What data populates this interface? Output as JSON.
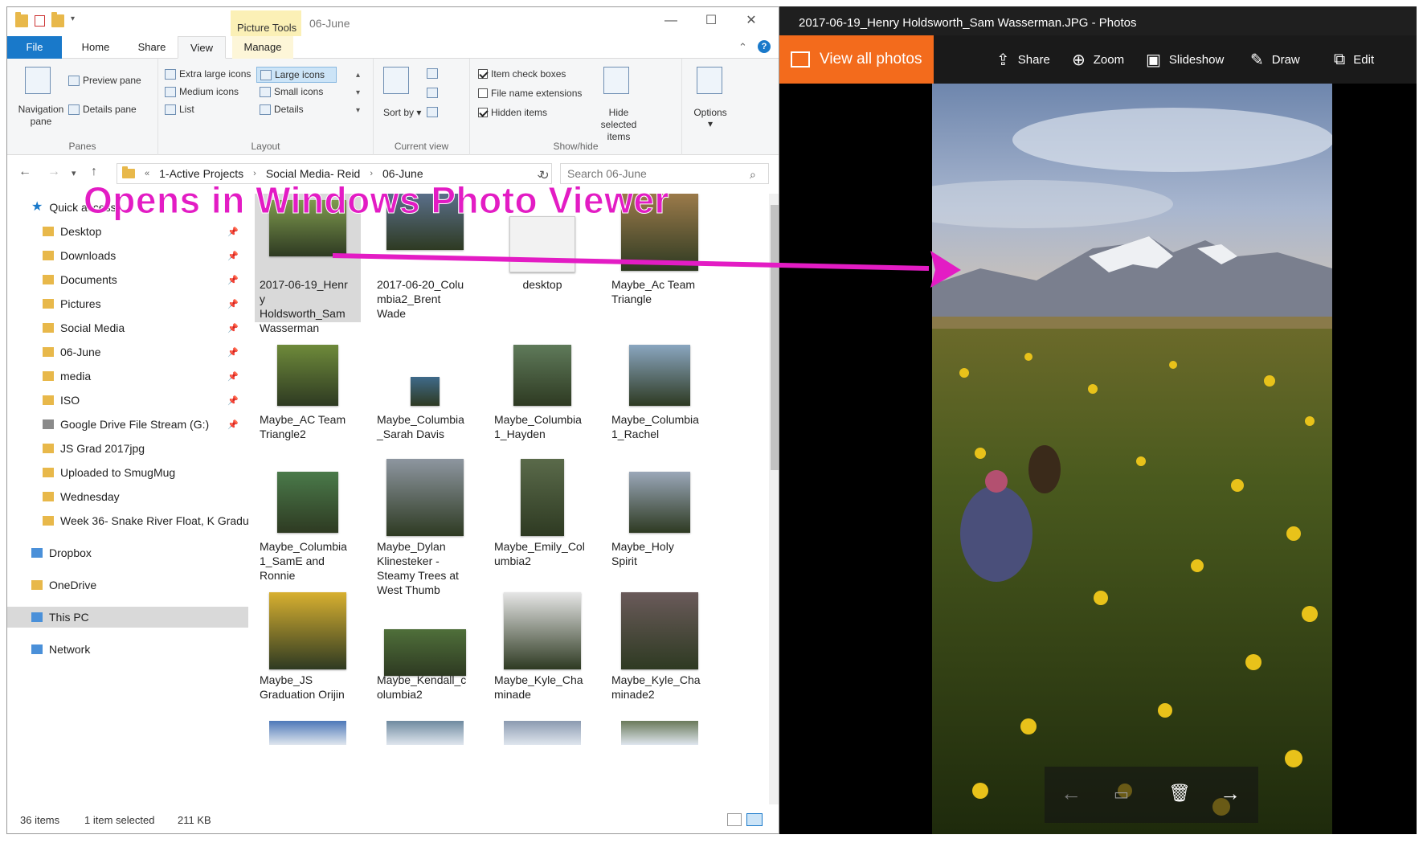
{
  "explorer": {
    "title": "06-June",
    "context_tab": "Picture Tools",
    "tabs": [
      "File",
      "Home",
      "Share",
      "View",
      "Manage"
    ],
    "ribbon": {
      "panes": {
        "navigation_pane": "Navigation pane",
        "preview_pane": "Preview pane",
        "details_pane": "Details pane",
        "label": "Panes"
      },
      "layout": {
        "items": [
          "Extra large icons",
          "Large icons",
          "Medium icons",
          "Small icons",
          "List",
          "Details"
        ],
        "selected": "Large icons",
        "label": "Layout"
      },
      "current_view": {
        "sort_by": "Sort by",
        "label": "Current view"
      },
      "show_hide": {
        "item_check_boxes": "Item check boxes",
        "file_name_extensions": "File name extensions",
        "hidden_items": "Hidden items",
        "hide_selected_items": "Hide selected items",
        "label": "Show/hide"
      },
      "options": "Options"
    },
    "address": {
      "crumbs": [
        "1-Active Projects",
        "Social Media- Reid",
        "06-June"
      ],
      "search_placeholder": "Search 06-June"
    },
    "nav": [
      {
        "label": "Quick access",
        "icon": "star-icon"
      },
      {
        "label": "Desktop",
        "pinned": true
      },
      {
        "label": "Downloads",
        "pinned": true
      },
      {
        "label": "Documents",
        "pinned": true
      },
      {
        "label": "Pictures",
        "pinned": true
      },
      {
        "label": "Social Media",
        "pinned": true
      },
      {
        "label": "06-June",
        "pinned": true
      },
      {
        "label": "media",
        "pinned": true
      },
      {
        "label": "ISO",
        "pinned": true
      },
      {
        "label": "Google Drive File Stream (G:)",
        "pinned": true
      },
      {
        "label": "JS Grad 2017jpg"
      },
      {
        "label": "Uploaded to SmugMug"
      },
      {
        "label": "Wednesday"
      },
      {
        "label": "Week 36- Snake River Float, K Gradu"
      },
      {
        "label": "Dropbox"
      },
      {
        "label": "OneDrive"
      },
      {
        "label": "This PC"
      },
      {
        "label": "Network"
      }
    ],
    "files": [
      {
        "name": "2017-06-19_Henry Holdsworth_Sam Wasserman",
        "lines": [
          "2017-06-19_Henr",
          "y",
          "Holdsworth_Sam",
          "Wasserman"
        ]
      },
      {
        "name": "2017-06-20_Columbia2_Brent Wade",
        "lines": [
          "2017-06-20_Colu",
          "mbia2_Brent",
          "Wade"
        ]
      },
      {
        "name": "desktop",
        "lines": [
          "desktop"
        ]
      },
      {
        "name": "Maybe_Ac Team Triangle",
        "lines": [
          "Maybe_Ac Team",
          "Triangle"
        ]
      },
      {
        "name": "Maybe_AC Team Triangle2",
        "lines": [
          "Maybe_AC Team",
          "Triangle2"
        ]
      },
      {
        "name": "Maybe_Columbia_Sarah Davis",
        "lines": [
          "Maybe_Columbia",
          "_Sarah Davis"
        ]
      },
      {
        "name": "Maybe_Columbia1_Hayden",
        "lines": [
          "Maybe_Columbia",
          "1_Hayden"
        ]
      },
      {
        "name": "Maybe_Columbia1_Rachel",
        "lines": [
          "Maybe_Columbia",
          "1_Rachel"
        ]
      },
      {
        "name": "Maybe_Columbia1_SamE and Ronnie",
        "lines": [
          "Maybe_Columbia",
          "1_SamE and",
          "Ronnie"
        ]
      },
      {
        "name": "Maybe_Dylan Klinesteker - Steamy Trees at West Thumb",
        "lines": [
          "Maybe_Dylan",
          "Klinesteker -",
          "Steamy Trees at",
          "West Thumb"
        ]
      },
      {
        "name": "Maybe_Emily_Columbia2",
        "lines": [
          "Maybe_Emily_Col",
          "umbia2"
        ]
      },
      {
        "name": "Maybe_Holy Spirit",
        "lines": [
          "Maybe_Holy",
          "Spirit"
        ]
      },
      {
        "name": "Maybe_JS Graduation Orijin",
        "lines": [
          "Maybe_JS",
          "Graduation Orijin"
        ]
      },
      {
        "name": "Maybe_Kendall_columbia2",
        "lines": [
          "Maybe_Kendall_c",
          "olumbia2"
        ]
      },
      {
        "name": "Maybe_Kyle_Chaminade",
        "lines": [
          "Maybe_Kyle_Cha",
          "minade"
        ]
      },
      {
        "name": "Maybe_Kyle_Chaminade2",
        "lines": [
          "Maybe_Kyle_Cha",
          "minade2"
        ]
      }
    ],
    "status": {
      "items": "36 items",
      "selected": "1 item selected",
      "size": "211 KB"
    }
  },
  "photos": {
    "title": "2017-06-19_Henry Holdsworth_Sam Wasserman.JPG - Photos",
    "view_all": "View all photos",
    "toolbar": [
      "Share",
      "Zoom",
      "Slideshow",
      "Draw",
      "Edit"
    ]
  },
  "annotation": {
    "text": "Opens in Windows Photo Viewer",
    "color": "#e31cc4"
  },
  "colors": {
    "accent": "#1979ca",
    "photos_orange": "#f36b1c"
  }
}
